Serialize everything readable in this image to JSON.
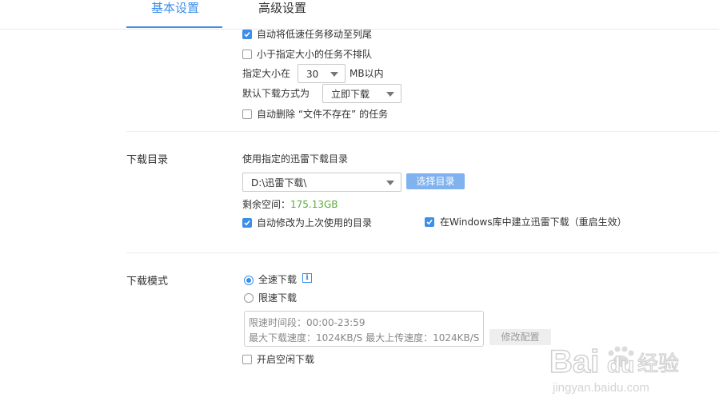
{
  "tabs": [
    {
      "label": "基本设置",
      "active": true
    },
    {
      "label": "高级设置",
      "active": false
    }
  ],
  "task": {
    "auto_move_slow": {
      "label": "自动将低速任务移动至列尾",
      "checked": true
    },
    "no_queue_small": {
      "label": "小于指定大小的任务不排队",
      "checked": false
    },
    "size_prefix": "指定大小在",
    "size_value": "30",
    "size_suffix": "MB以内",
    "default_mode_label": "默认下载方式为",
    "default_mode_value": "立即下载",
    "auto_delete": {
      "label": "自动删除 “文件不存在” 的任务",
      "checked": false
    }
  },
  "download_dir": {
    "section_label": "下载目录",
    "heading": "使用指定的迅雷下载目录",
    "path": "D:\\迅雷下载\\",
    "choose_button": "选择目录",
    "free_label": "剩余空间：",
    "free_value": "175.13GB",
    "auto_modify": {
      "label": "自动修改为上次使用的目录",
      "checked": true
    },
    "windows_lib": {
      "label": "在Windows库中建立迅雷下载（重启生效）",
      "checked": true
    }
  },
  "download_mode": {
    "section_label": "下载模式",
    "full_speed": {
      "label": "全速下载",
      "checked": true
    },
    "limited": {
      "label": "限速下载",
      "checked": false
    },
    "limit_time": "限速时间段：00:00-23:59",
    "limit_speed": "最大下载速度：1024KB/S  最大上传速度：1024KB/S",
    "modify_button": "修改配置",
    "idle_download": {
      "label": "开启空闲下载",
      "checked": false
    }
  },
  "watermark": {
    "brand": "Bai",
    "brand_paw": "du",
    "brand_cn": "经验",
    "url": "jingyan.baidu.com"
  },
  "colors": {
    "accent": "#3d8ee8",
    "free_space": "#5aaa3c",
    "button": "#7fb2ee"
  }
}
